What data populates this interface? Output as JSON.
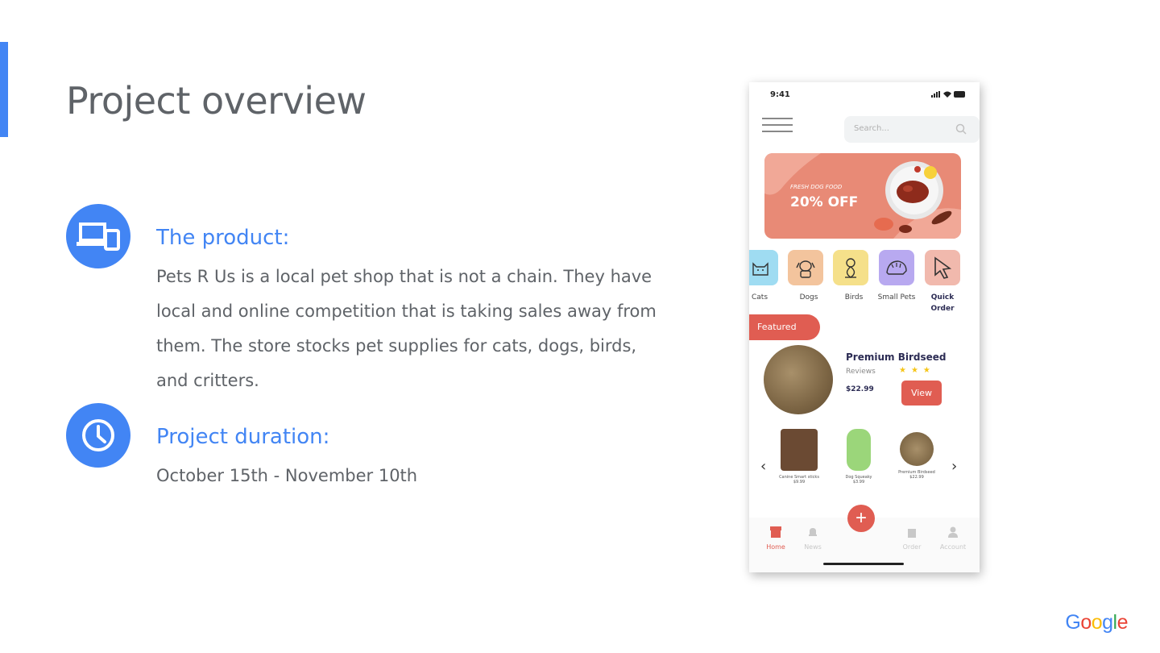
{
  "slide": {
    "title": "Project overview",
    "colors": {
      "accent": "#4285f4",
      "text": "#5f6368"
    }
  },
  "sections": {
    "product": {
      "icon": "devices-icon",
      "heading": "The product:",
      "body": "Pets R Us is a local pet shop that is not a chain. They have local and online competition that is taking sales away from them. The store stocks pet supplies for cats, dogs, birds, and critters."
    },
    "duration": {
      "icon": "clock-icon",
      "heading": "Project duration:",
      "body": "October 15th - November 10th"
    }
  },
  "phone": {
    "status_time": "9:41",
    "search_placeholder": "Search...",
    "banner": {
      "subtitle": "FRESH DOG FOOD",
      "headline": "20% OFF"
    },
    "categories": [
      {
        "label": "Cats",
        "color": "#9fdcf2",
        "icon": "cat-icon"
      },
      {
        "label": "Dogs",
        "color": "#f3c49d",
        "icon": "dog-icon"
      },
      {
        "label": "Birds",
        "color": "#f5e08a",
        "icon": "bird-icon"
      },
      {
        "label": "Small Pets",
        "color": "#b8a9f0",
        "icon": "hedgehog-icon"
      },
      {
        "label": "Quick Order",
        "color": "#f1b9ad",
        "icon": "cursor-icon"
      }
    ],
    "featured": {
      "tag": "Featured",
      "title": "Premium Birdseed",
      "reviews_label": "Reviews",
      "rating": 3,
      "price": "$22.99",
      "view_label": "View"
    },
    "mini_products": [
      {
        "name": "Canine Smart sticks",
        "price": "$9.99",
        "color": "#6b4a33"
      },
      {
        "name": "Dog Squeaky",
        "price": "$3.99",
        "color": "#9bd67a"
      },
      {
        "name": "Premium Birdseed",
        "price": "$22.99",
        "color": "#8a7150"
      }
    ],
    "nav": [
      {
        "label": "Home",
        "icon": "store-icon",
        "active": true
      },
      {
        "label": "News",
        "icon": "bell-icon",
        "active": false
      },
      {
        "label": "Order",
        "icon": "bag-icon",
        "active": false
      },
      {
        "label": "Account",
        "icon": "user-icon",
        "active": false
      }
    ],
    "fab_label": "+"
  },
  "footer": {
    "logo": "Google"
  }
}
